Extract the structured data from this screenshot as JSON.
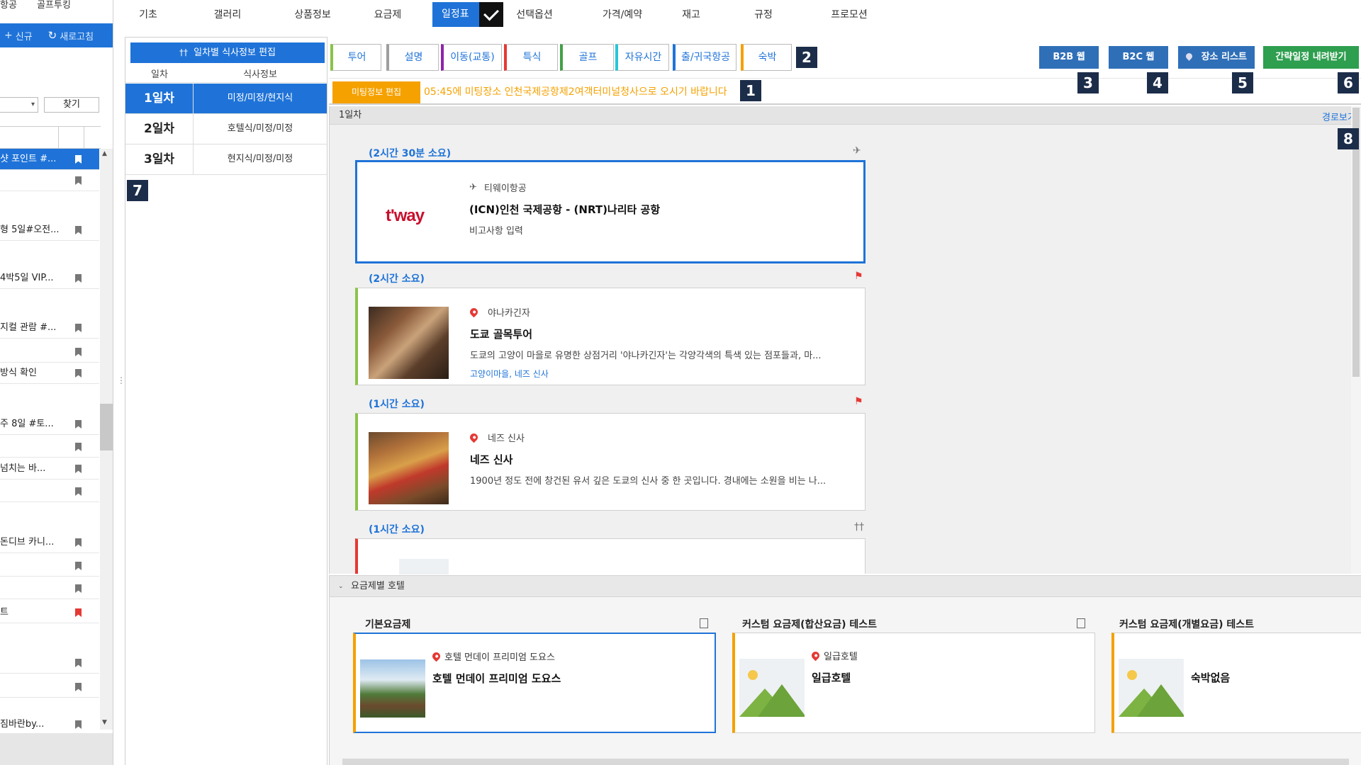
{
  "sidebar": {
    "top_tabs": [
      "항공",
      "골프투킹"
    ],
    "actions": [
      {
        "label": "신규",
        "icon": "plus-icon"
      },
      {
        "label": "새로고침",
        "icon": "refresh-icon"
      }
    ],
    "find_label": "찾기",
    "items": [
      {
        "label": "샷 포인트 #...",
        "selected": true,
        "bookmark": "white"
      },
      {
        "label": "",
        "bookmark": "grey"
      },
      {
        "label": "형 5일#오전...",
        "bookmark": "grey"
      },
      {
        "label": "4박5일 VIP...",
        "bookmark": "grey"
      },
      {
        "label": "지컬 관람 #...",
        "bookmark": "grey"
      },
      {
        "label": "",
        "bookmark": "grey"
      },
      {
        "label": "방식 확인",
        "bookmark": "grey"
      },
      {
        "label": "주 8일 #토...",
        "bookmark": "grey"
      },
      {
        "label": "",
        "bookmark": "grey"
      },
      {
        "label": "넘치는 바...",
        "bookmark": "grey"
      },
      {
        "label": "",
        "bookmark": "grey"
      },
      {
        "label": "돈디브 카니...",
        "bookmark": "grey"
      },
      {
        "label": "",
        "bookmark": "grey"
      },
      {
        "label": "",
        "bookmark": "grey"
      },
      {
        "label": "트",
        "bookmark": "red"
      },
      {
        "label": "",
        "bookmark": "grey"
      },
      {
        "label": "",
        "bookmark": "grey"
      },
      {
        "label": "짐바란by...",
        "bookmark": "grey"
      }
    ]
  },
  "topnav": {
    "tabs": [
      "기초",
      "갤러리",
      "상품정보",
      "요금제",
      "일정표",
      "선택옵션",
      "가격/예약",
      "재고",
      "규정",
      "프로모션"
    ],
    "active_tab": "일정표"
  },
  "meal_panel": {
    "header_button": "일차별 식사정보 편집",
    "col_day": "일차",
    "col_meal": "식사정보",
    "rows": [
      {
        "day": "1일차",
        "meal": "미정/미정/현지식",
        "active": true
      },
      {
        "day": "2일차",
        "meal": "호텔식/미정/미정"
      },
      {
        "day": "3일차",
        "meal": "현지식/미정/미정"
      }
    ]
  },
  "categories": [
    {
      "label": "투어",
      "color": "#8bc34a"
    },
    {
      "label": "설명",
      "color": "#9e9e9e"
    },
    {
      "label": "이동(교통)",
      "color": "#8e24aa"
    },
    {
      "label": "특식",
      "color": "#e53935"
    },
    {
      "label": "골프",
      "color": "#43a047"
    },
    {
      "label": "자유시간",
      "color": "#26c6da"
    },
    {
      "label": "출/귀국항공",
      "color": "#1f73d8"
    },
    {
      "label": "숙박",
      "color": "#f5a100"
    }
  ],
  "right_buttons": {
    "b2b": "B2B 웹",
    "b2c": "B2C 웹",
    "places": "장소 리스트",
    "download": "간략일정 내려받기"
  },
  "badges": [
    "1",
    "2",
    "3",
    "4",
    "5",
    "6",
    "7",
    "8"
  ],
  "meeting": {
    "button": "미팅정보 편집",
    "message": "05:45에 미팅장소 인천국제공항제2여객터미널청사으로 오시기 바랍니다"
  },
  "schedule": {
    "day_label": "1일차",
    "route_link": "경로보기",
    "items": [
      {
        "duration": "(2시간 30분 소요)",
        "icon": "airplane-icon",
        "location": "티웨이항공",
        "title": "(ICN)인천 국제공항 - (NRT)나리타 공항",
        "desc": "비고사항 입력",
        "logo": "t'way"
      },
      {
        "duration": "(2시간 소요)",
        "icon": "flag-icon",
        "location": "야나카긴자",
        "title": "도쿄 골목투어",
        "desc": "도쿄의 고양이 마을로 유명한 상점거리 '야나카긴자'는 각양각색의 특색 있는 점포들과, 마...",
        "tags": "고양이마을, 네즈 신사"
      },
      {
        "duration": "(1시간 소요)",
        "icon": "flag-icon",
        "location": "네즈 신사",
        "title": "네즈 신사",
        "desc": "1900년 정도 전에 창건된 유서 깊은 도쿄의 신사 중 한 곳입니다. 경내에는 소원을 비는 나..."
      },
      {
        "duration": "(1시간 소요)",
        "icon": "fork-knife-icon"
      }
    ]
  },
  "hotels": {
    "section_label": "요금제별 호텔",
    "plans": [
      {
        "plan": "기본요금제",
        "location": "호텔 먼데이 프리미엄 도요스",
        "name": "호텔 먼데이 프리미엄 도요스",
        "selected": true
      },
      {
        "plan": "커스텀 요금제(합산요금) 테스트",
        "location": "일급호텔",
        "name": "일급호텔"
      },
      {
        "plan": "커스텀 요금제(개별요금) 테스트",
        "location": "",
        "name": "숙박없음"
      }
    ]
  },
  "colors": {
    "primary": "#1f73d8",
    "accent": "#f5a100",
    "badge": "#1c2d4a",
    "download": "#2e9e4f"
  }
}
